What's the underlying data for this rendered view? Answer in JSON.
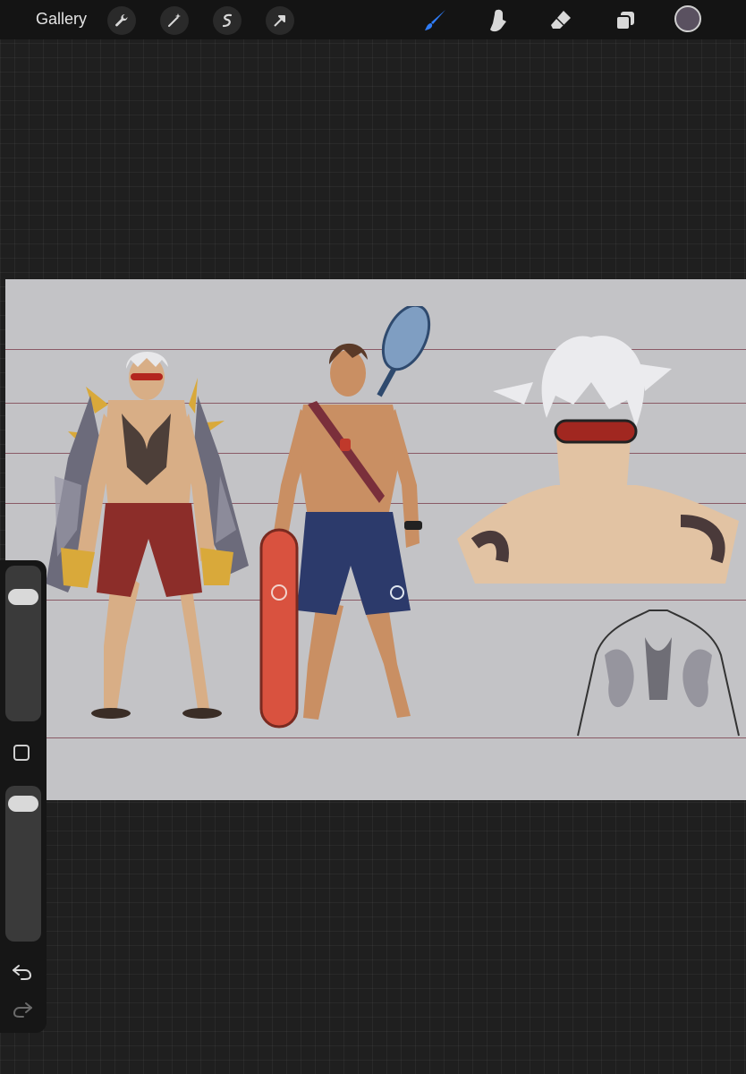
{
  "app": {
    "gallery_label": "Gallery",
    "toolbar_left": [
      "wrench-icon",
      "magic-wand-icon",
      "selection-icon",
      "transform-arrow-icon"
    ],
    "toolbar_right": [
      "brush-icon",
      "smudge-icon",
      "eraser-icon",
      "layers-icon"
    ],
    "active_tool": "brush",
    "accent_color": "#2f7cf6",
    "current_color": "#5a5160"
  },
  "canvas": {
    "background_color": "#c3c3c6",
    "guide_color": "#8a5a66",
    "subjects": [
      "white-haired-man-in-robe",
      "lifeguard-with-rescue-buoy-and-net",
      "portrait-with-red-goggles",
      "tattoo-back-sketch"
    ]
  },
  "sidebar": {
    "brush_size_level": 0.15,
    "opacity_level": 0.05,
    "undo_icon": "undo-icon",
    "redo_icon": "redo-icon"
  }
}
